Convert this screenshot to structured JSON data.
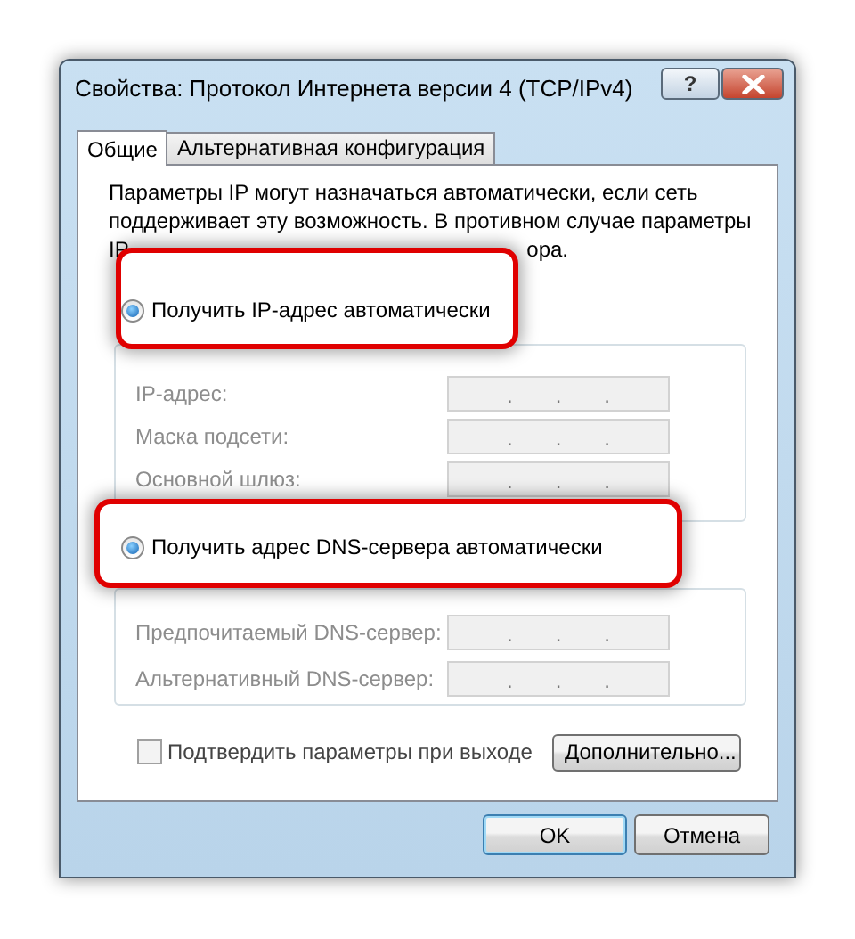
{
  "window": {
    "title": "Свойства: Протокол Интернета версии 4 (TCP/IPv4)"
  },
  "title_buttons": [
    {
      "kind": "help",
      "label": "?"
    },
    {
      "kind": "close"
    }
  ],
  "tabs": [
    {
      "label": "Общие",
      "selected": true
    },
    {
      "label": "Альтернативная конфигурация",
      "selected": false
    }
  ],
  "description_lines": [
    "Параметры IP могут назначаться автоматически, если сеть",
    "поддерживает эту возможность. В противном случае параметры"
  ],
  "covered_line": {
    "start": "IP",
    "end": "ора."
  },
  "ip_section": {
    "radios": [
      {
        "label": "Получить IP-адрес автоматически",
        "selected": true
      }
    ],
    "fields": [
      {
        "label": "IP-адрес:",
        "separators": [
          ".",
          ".",
          "."
        ],
        "disabled": true
      },
      {
        "label": "Маска подсети:",
        "separators": [
          ".",
          ".",
          "."
        ],
        "disabled": true
      },
      {
        "label": "Основной шлюз:",
        "separators": [
          ".",
          ".",
          "."
        ],
        "disabled": true
      }
    ]
  },
  "dns_section": {
    "radios": [
      {
        "label": "Получить адрес DNS-сервера автоматически",
        "selected": true
      }
    ],
    "fields": [
      {
        "label": "Предпочитаемый DNS-сервер:",
        "separators": [
          ".",
          ".",
          "."
        ],
        "disabled": true
      },
      {
        "label": "Альтернативный DNS-сервер:",
        "separators": [
          ".",
          ".",
          "."
        ],
        "disabled": true
      }
    ]
  },
  "validate_checkbox": {
    "label": "Подтвердить параметры при выходе",
    "checked": false
  },
  "advanced_button": "Дополнительно...",
  "buttons": [
    {
      "label": "OK",
      "default": true
    },
    {
      "label": "Отмена",
      "default": false
    }
  ]
}
